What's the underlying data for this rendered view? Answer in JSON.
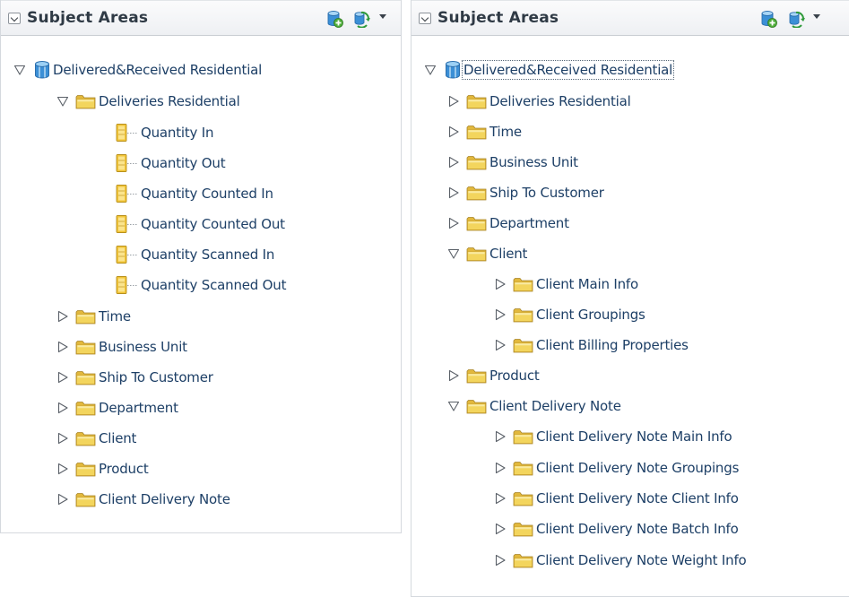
{
  "colors": {
    "folder": "#f3d55d",
    "link": "#1d3f66",
    "header_text": "#2f3a45",
    "root_icon": "#3b8fd6"
  },
  "left_panel": {
    "title": "Subject Areas",
    "rows": [
      {
        "label": "Delivered&Received Residential",
        "type": "root",
        "state": "expanded"
      },
      {
        "label": "Deliveries Residential",
        "type": "folder",
        "state": "expanded"
      },
      {
        "label": "Quantity In",
        "type": "column"
      },
      {
        "label": "Quantity Out",
        "type": "column"
      },
      {
        "label": "Quantity Counted In",
        "type": "column"
      },
      {
        "label": "Quantity Counted Out",
        "type": "column"
      },
      {
        "label": "Quantity Scanned In",
        "type": "column"
      },
      {
        "label": "Quantity Scanned Out",
        "type": "column"
      },
      {
        "label": "Time",
        "type": "folder",
        "state": "collapsed"
      },
      {
        "label": "Business Unit",
        "type": "folder",
        "state": "collapsed"
      },
      {
        "label": "Ship To Customer",
        "type": "folder",
        "state": "collapsed"
      },
      {
        "label": "Department",
        "type": "folder",
        "state": "collapsed"
      },
      {
        "label": "Client",
        "type": "folder",
        "state": "collapsed"
      },
      {
        "label": "Product",
        "type": "folder",
        "state": "collapsed"
      },
      {
        "label": "Client Delivery Note",
        "type": "folder",
        "state": "collapsed"
      }
    ]
  },
  "right_panel": {
    "title": "Subject Areas",
    "rows": [
      {
        "label": "Delivered&Received Residential",
        "type": "root",
        "state": "expanded",
        "selected": true
      },
      {
        "label": "Deliveries Residential",
        "type": "folder",
        "state": "collapsed"
      },
      {
        "label": "Time",
        "type": "folder",
        "state": "collapsed"
      },
      {
        "label": "Business Unit",
        "type": "folder",
        "state": "collapsed"
      },
      {
        "label": "Ship To Customer",
        "type": "folder",
        "state": "collapsed"
      },
      {
        "label": "Department",
        "type": "folder",
        "state": "collapsed"
      },
      {
        "label": "Client",
        "type": "folder",
        "state": "expanded"
      },
      {
        "label": "Client Main Info",
        "type": "folder",
        "state": "collapsed"
      },
      {
        "label": "Client Groupings",
        "type": "folder",
        "state": "collapsed"
      },
      {
        "label": "Client Billing Properties",
        "type": "folder",
        "state": "collapsed"
      },
      {
        "label": "Product",
        "type": "folder",
        "state": "collapsed"
      },
      {
        "label": "Client Delivery Note",
        "type": "folder",
        "state": "expanded"
      },
      {
        "label": "Client Delivery Note Main Info",
        "type": "folder",
        "state": "collapsed"
      },
      {
        "label": "Client Delivery Note Groupings",
        "type": "folder",
        "state": "collapsed"
      },
      {
        "label": "Client Delivery Note Client Info",
        "type": "folder",
        "state": "collapsed"
      },
      {
        "label": "Client Delivery Note Batch Info",
        "type": "folder",
        "state": "collapsed"
      },
      {
        "label": "Client Delivery Note Weight Info",
        "type": "folder",
        "state": "collapsed"
      }
    ]
  }
}
